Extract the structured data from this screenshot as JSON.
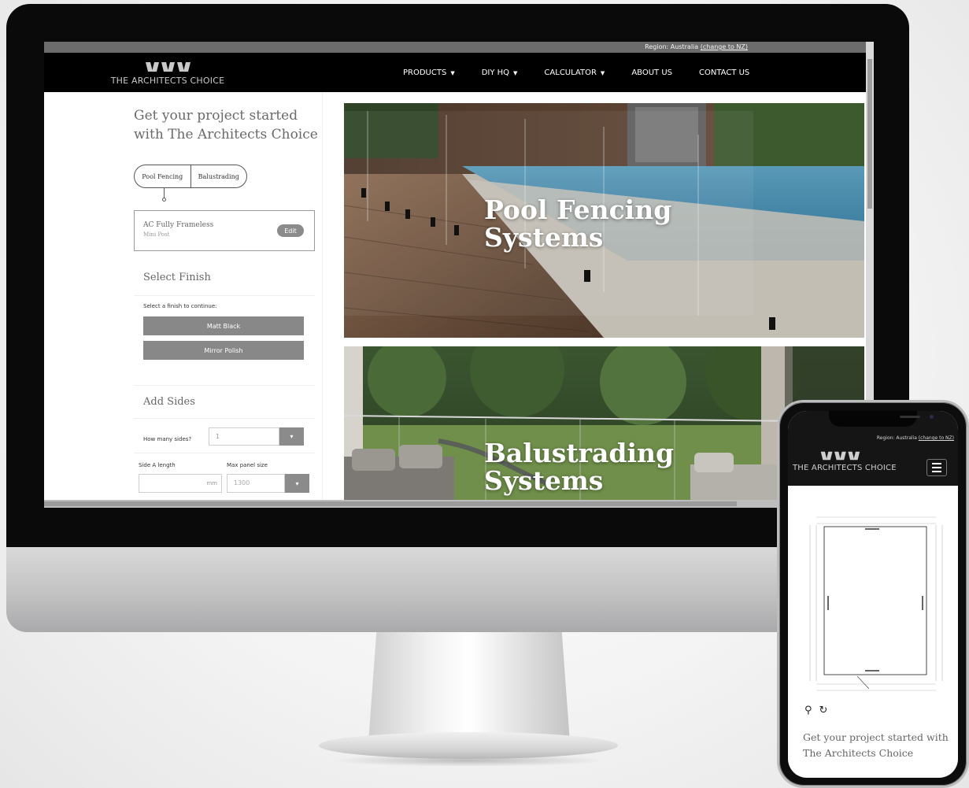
{
  "desktop": {
    "region": {
      "text": "Region: Australia ",
      "link": "(change to NZ)"
    },
    "logo_text": "THE ARCHITECTS CHOICE",
    "nav": [
      {
        "label": "PRODUCTS",
        "dropdown": true
      },
      {
        "label": "DIY HQ",
        "dropdown": true
      },
      {
        "label": "CALCULATOR",
        "dropdown": true
      },
      {
        "label": "ABOUT US",
        "dropdown": false
      },
      {
        "label": "CONTACT US",
        "dropdown": false
      }
    ],
    "panel": {
      "heading": "Get your project started with The Architects Choice",
      "toggle": {
        "option1": "Pool Fencing",
        "option2": "Balustrading"
      },
      "product": {
        "name": "AC Fully Frameless",
        "sub": "Mini Post",
        "edit_label": "Edit"
      },
      "finish": {
        "title": "Select Finish",
        "prompt": "Select a finish to continue:",
        "options": [
          "Matt Black",
          "Mirror Polish"
        ]
      },
      "sides": {
        "title": "Add Sides",
        "label": "How many sides?",
        "value": "1",
        "side_a_label": "Side A length",
        "unit": "mm",
        "max_panel_label": "Max panel size",
        "max_panel_value": "1300"
      }
    },
    "heroes": {
      "pool_title": "Pool Fencing\nSystems",
      "balustrade_title": "Balustrading\nSystems"
    }
  },
  "mobile": {
    "region": {
      "text": "Region: Australia ",
      "link": "(change to NZ)"
    },
    "logo_text": "THE ARCHITECTS CHOICE",
    "heading": "Get your project started with The Architects Choice"
  },
  "colors": {
    "nav_bg": "#000000",
    "region_bar": "#6c6c6c",
    "button_grey": "#888888",
    "heading_text": "#6a6a6a"
  },
  "icons": [
    "logo-mark-icon",
    "chevron-down-icon",
    "menu-icon",
    "zoom-icon",
    "rotate-icon"
  ]
}
